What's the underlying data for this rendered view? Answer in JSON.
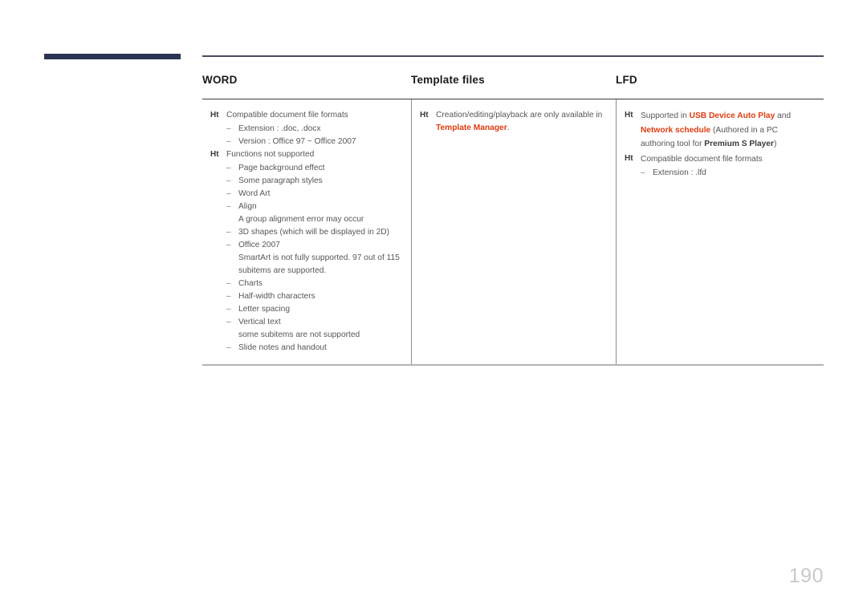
{
  "page": {
    "number": "190",
    "marker_glyph": "Ht",
    "dash_glyph": "–",
    "accent_color": "#df3c11",
    "navy_color": "#2b3450"
  },
  "columns": [
    {
      "header": "WORD",
      "groups": [
        {
          "marker": "Ht",
          "text": "Compatible document file formats",
          "subitems": [
            {
              "text": "Extension : .doc, .docx"
            },
            {
              "text": "Version : Office 97 ~ Office 2007"
            }
          ]
        },
        {
          "marker": "Ht",
          "text": "Functions not supported",
          "subitems": [
            {
              "text": "Page background effect"
            },
            {
              "text": "Some paragraph styles"
            },
            {
              "text": "Word Art"
            },
            {
              "text": "Align",
              "note": "A group alignment error may occur"
            },
            {
              "text": "3D shapes (which will be displayed in 2D)"
            },
            {
              "text": "Office 2007",
              "note": "SmartArt is not fully supported. 97 out of 115 subitems are supported."
            },
            {
              "text": "Charts"
            },
            {
              "text": "Half-width characters"
            },
            {
              "text": "Letter spacing"
            },
            {
              "text": "Vertical text",
              "note": "some subitems are not supported"
            },
            {
              "text": "Slide notes and handout"
            }
          ]
        }
      ]
    },
    {
      "header": "Template files",
      "notice": {
        "marker": "Ht",
        "lead": "Creation/editing/playback are only available in ",
        "highlight": "Template Manager",
        "tail": "."
      }
    },
    {
      "header": "LFD",
      "supported": {
        "marker": "Ht",
        "part1": "Supported in ",
        "hl1": "USB Device Auto Play",
        "part2": " and ",
        "hl2": "Network schedule",
        "part3": " (Authored in a PC authoring tool for ",
        "bold1": "Premium S Player",
        "part4": ")"
      },
      "formats": {
        "marker": "Ht",
        "text": "Compatible document file formats",
        "subitems": [
          {
            "text": "Extension : .lfd"
          }
        ]
      }
    }
  ]
}
